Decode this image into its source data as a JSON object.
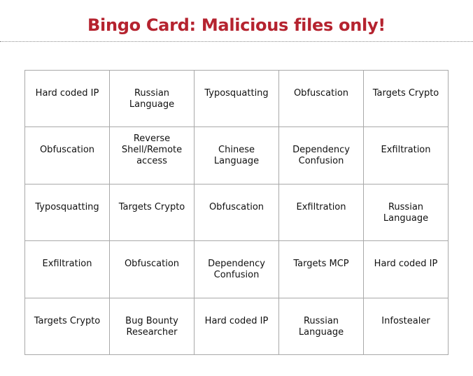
{
  "title": "Bingo Card: Malicious files only!",
  "grid": {
    "rows": [
      [
        "Hard coded IP",
        "Russian Language",
        "Typosquatting",
        "Obfuscation",
        "Targets Crypto"
      ],
      [
        "Obfuscation",
        "Reverse Shell/Remote access",
        "Chinese Language",
        "Dependency Confusion",
        "Exfiltration"
      ],
      [
        "Typosquatting",
        "Targets Crypto",
        "Obfuscation",
        "Exfiltration",
        "Russian Language"
      ],
      [
        "Exfiltration",
        "Obfuscation",
        "Dependency Confusion",
        "Targets MCP",
        "Hard coded IP"
      ],
      [
        "Targets Crypto",
        "Bug Bounty Researcher",
        "Hard coded IP",
        "Russian Language",
        "Infostealer"
      ]
    ]
  },
  "colors": {
    "title": "#b5232f",
    "grid_border": "#a9a9a9",
    "text": "#111111"
  }
}
